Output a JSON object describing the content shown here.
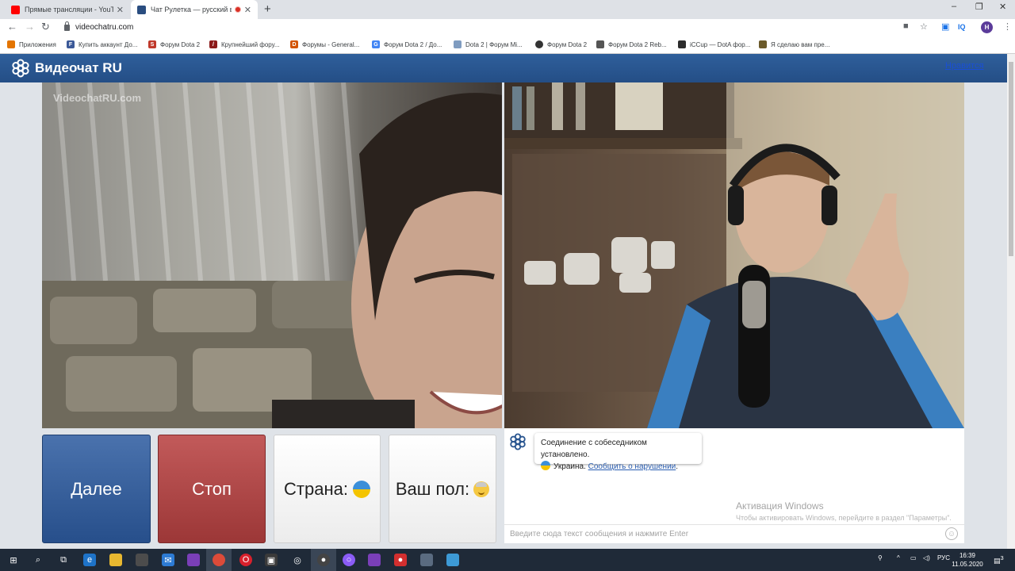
{
  "browser": {
    "tabs": [
      {
        "title": "Прямые трансляции - YouTube",
        "favicon_color": "#ff0000"
      },
      {
        "title": "Чат Рулетка — русский вид",
        "favicon_color": "#2a4d80",
        "recording": true
      }
    ],
    "new_tab_symbol": "+",
    "window_controls": [
      "–",
      "❐",
      "✕"
    ],
    "url": "videochatru.com",
    "profile_initial": "H",
    "bookmarks": [
      {
        "label": "Приложения",
        "icon": "apps-grid-icon",
        "color": "#e37400"
      },
      {
        "label": "Купить аккаунт До...",
        "icon": "f-icon",
        "color": "#3b5998"
      },
      {
        "label": "Форум Dota 2",
        "icon": "s-icon",
        "color": "#c0392b"
      },
      {
        "label": "Крупнейший фору...",
        "icon": "slash-icon",
        "color": "#8b1a1a"
      },
      {
        "label": "Форумы - General...",
        "icon": "d-icon",
        "color": "#d35400"
      },
      {
        "label": "Форум Dota 2 / До...",
        "icon": "google-icon",
        "color": "#4285f4"
      },
      {
        "label": "Dota 2 | Форум Mi...",
        "icon": "cloud-icon",
        "color": "#7f9cc0"
      },
      {
        "label": "Форум Dota 2",
        "icon": "circle-icon",
        "color": "#333333"
      },
      {
        "label": "Форум Dota 2 Reb...",
        "icon": "doc-icon",
        "color": "#555555"
      },
      {
        "label": "iCCup — DotA фор...",
        "icon": "tip-icon",
        "color": "#2c2c2c"
      },
      {
        "label": "Я сделаю вам пре...",
        "icon": "k-icon",
        "color": "#6b5a2a"
      }
    ]
  },
  "site": {
    "logo_text": "Видеочат RU",
    "like_link": "Нравится",
    "watermark": "VideochatRU.com",
    "buttons": {
      "next": "Далее",
      "stop": "Стоп",
      "country": "Страна:",
      "gender": "Ваш пол:"
    },
    "chat": {
      "message_line1": "Соединение с собеседником установлено.",
      "country": "Украина.",
      "report_link": "Сообщить о нарушении",
      "report_suffix": ".",
      "input_placeholder": "Введите сюда текст сообщения и нажмите Enter",
      "activation_title": "Активация Windows",
      "activation_sub": "Чтобы активировать Windows, перейдите в раздел \"Параметры\"."
    },
    "colors": {
      "header": "#2a5690",
      "next_button": "#274f8b",
      "stop_button": "#9c3737"
    }
  },
  "taskbar": {
    "language": "РУС",
    "time": "16:39",
    "date": "11.05.2020",
    "notifications": "3"
  }
}
